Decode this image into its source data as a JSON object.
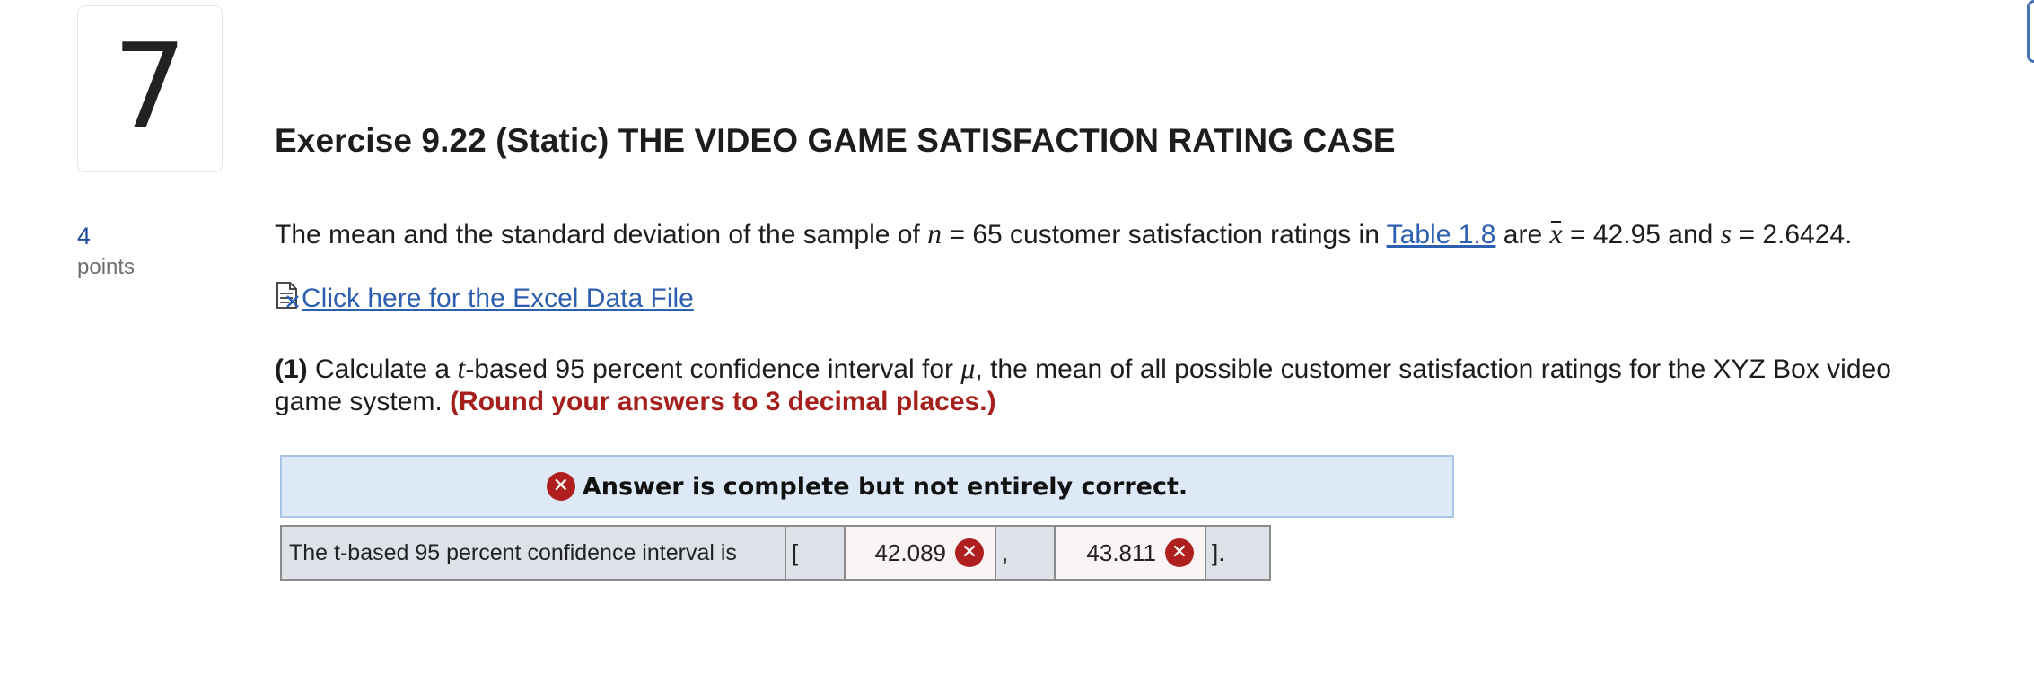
{
  "question": {
    "number": "7",
    "points_value": "4",
    "points_label": "points",
    "title": "Exercise 9.22 (Static) THE VIDEO GAME SATISFACTION RATING CASE"
  },
  "paragraph1": {
    "part1": "The mean and the standard deviation of the sample of ",
    "n_symbol": "n",
    "part2": " = 65 customer satisfaction ratings in ",
    "table_link": "Table 1.8",
    "part3": " are ",
    "xbar_symbol": "x",
    "part4": " = 42.95 and ",
    "s_symbol": "s",
    "part5": " = 2.6424."
  },
  "excel_link": {
    "icon": "excel-file-icon",
    "label": " Click here for the Excel Data File"
  },
  "paragraph2": {
    "part_number": "(1)",
    "text1": " Calculate a ",
    "t_symbol": "t",
    "text2": "-based 95 percent confidence interval for ",
    "mu_symbol": "μ",
    "text3": ", the mean of all possible customer satisfaction ratings for the XYZ Box video game system. ",
    "instruction": "(Round your answers to 3 decimal places.)"
  },
  "feedback": {
    "icon": "error-x-icon",
    "message": "Answer is complete but not entirely correct.",
    "status_color": "#b01f1f"
  },
  "answer_row": {
    "label": "The t-based 95 percent confidence interval is",
    "open_bracket": "[",
    "lower_value": "42.089",
    "separator": ",",
    "upper_value": "43.811",
    "close_bracket": "]."
  }
}
